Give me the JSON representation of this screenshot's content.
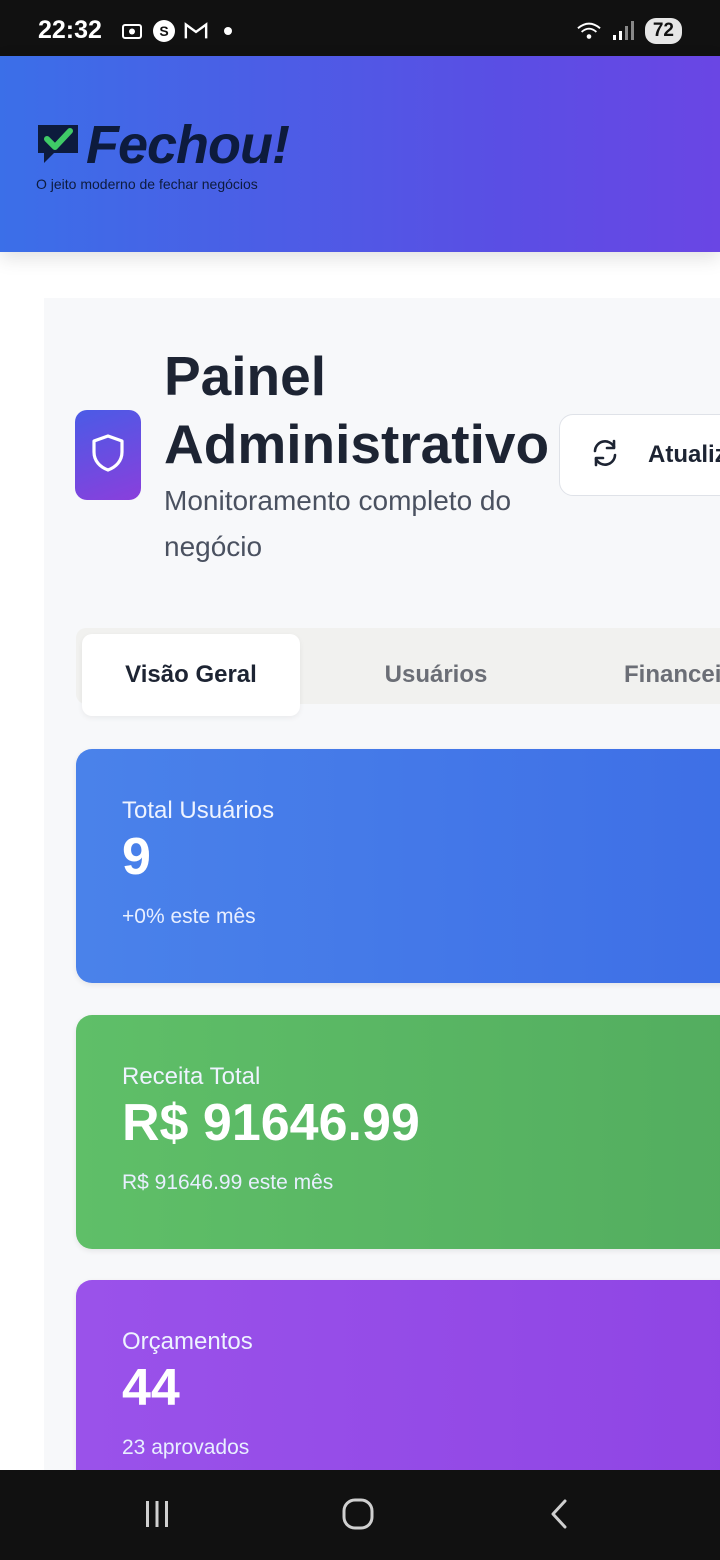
{
  "status": {
    "time": "22:32",
    "battery": "72",
    "left_icons": [
      "screenshot-icon",
      "s-app-icon",
      "gmail-icon",
      "dot-icon"
    ],
    "right_icons": [
      "wifi-icon",
      "signal-icon"
    ]
  },
  "header": {
    "brand": "Fechou!",
    "tagline": "O jeito moderno de fechar negócios"
  },
  "page": {
    "title": "Painel Administrativo",
    "subtitle": "Monitoramento completo do negócio",
    "refresh_label": "Atualiz",
    "badge_icon": "shield-icon"
  },
  "tabs": [
    {
      "label": "Visão Geral",
      "active": true
    },
    {
      "label": "Usuários",
      "active": false
    },
    {
      "label": "Financei",
      "active": false
    }
  ],
  "cards": [
    {
      "label": "Total Usuários",
      "value": "9",
      "sub": "+0% este mês",
      "color": "#4a82ea"
    },
    {
      "label": "Receita Total",
      "value": "R$ 91646.99",
      "sub": "R$ 91646.99 este mês",
      "color": "#5fbf68"
    },
    {
      "label": "Orçamentos",
      "value": "44",
      "sub": "23 aprovados",
      "color": "#9a52ea"
    }
  ],
  "nav": [
    "recents-icon",
    "home-icon",
    "back-icon"
  ]
}
